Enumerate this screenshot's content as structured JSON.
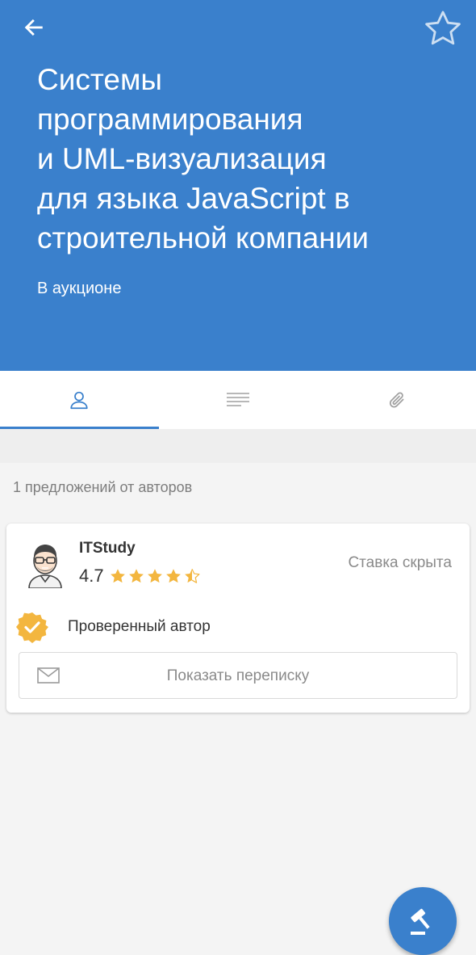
{
  "header": {
    "title": "Системы\nпрограммирования\nи UML-визуализация\nдля языка JavaScript в\nстроительной компании",
    "status": "В аукционе",
    "background_color": "#3a80cc",
    "back_icon": "arrow-left-icon",
    "favorite_icon": "star-outline-icon"
  },
  "tabs": [
    {
      "icon": "person-icon",
      "active": true
    },
    {
      "icon": "text-lines-icon",
      "active": false
    },
    {
      "icon": "paperclip-icon",
      "active": false
    }
  ],
  "offers": {
    "count_text": "1 предложений от авторов",
    "items": [
      {
        "author": "ITStudy",
        "rating": "4.7",
        "rating_stars": 4.7,
        "bid_text": "Ставка скрыта",
        "verified_text": "Проверенный автор",
        "show_messages_label": "Показать переписку"
      }
    ]
  },
  "fab": {
    "icon": "gavel-icon"
  },
  "colors": {
    "accent": "#3a80cc",
    "star": "#f3b63f",
    "verified_badge": "#f3b63f"
  }
}
